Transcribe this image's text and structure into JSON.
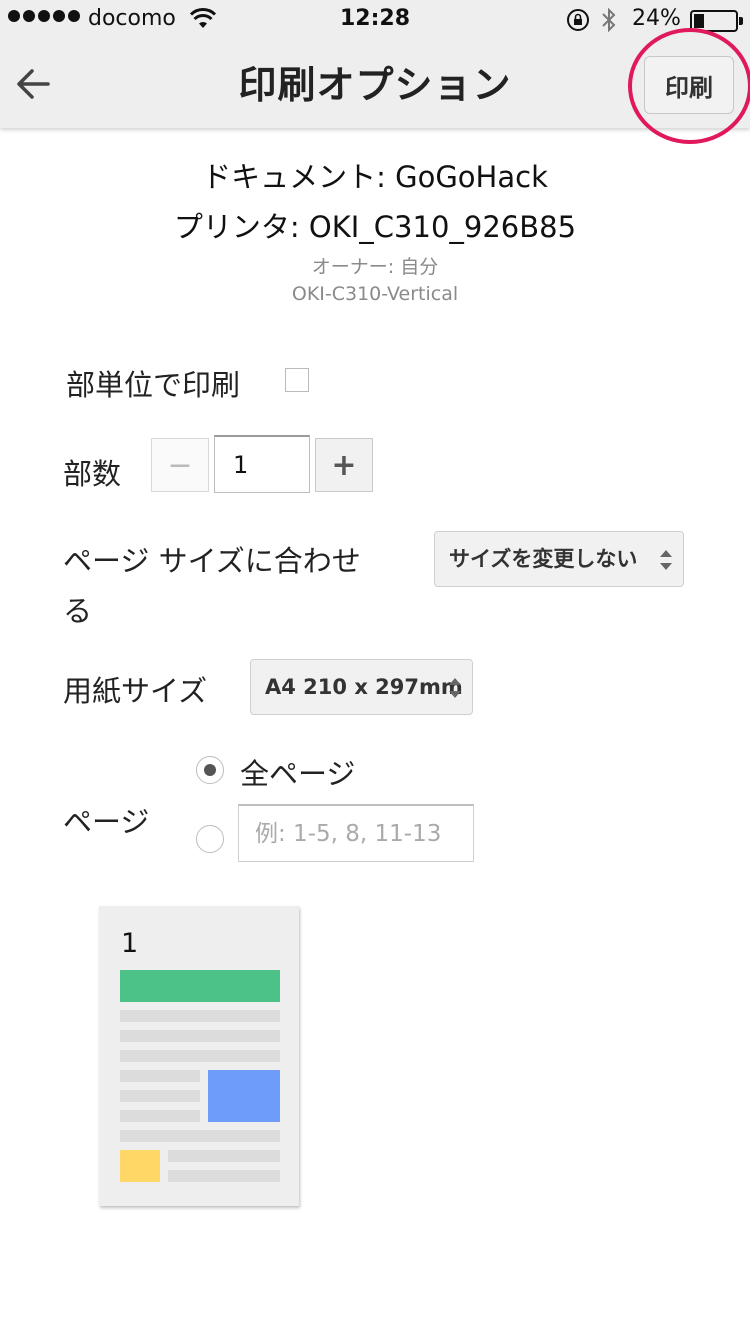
{
  "status_bar": {
    "carrier": "docomo",
    "time": "12:28",
    "battery_percent": "24%",
    "battery_level": 0.24,
    "icons": [
      "signal-dots-icon",
      "wifi-icon",
      "rotation-lock-icon",
      "bluetooth-icon",
      "battery-icon"
    ]
  },
  "header": {
    "back_icon": "arrow-left-icon",
    "title": "印刷オプション",
    "print_label": "印刷",
    "highlight_color": "#e0195a"
  },
  "document": {
    "document_line": "ドキュメント: GoGoHack",
    "printer_line": "プリンタ: OKI_C310_926B85",
    "owner_line": "オーナー: 自分",
    "model_line": "OKI-C310-Vertical"
  },
  "options": {
    "collate_label": "部単位で印刷",
    "collate_checked": false,
    "copies_label": "部数",
    "copies_minus": "−",
    "copies_value": "1",
    "copies_plus": "+",
    "fit_label_line1": "ページ サイズに合わせせ",
    "fit_label_line1_exact": "ページ サイズに合わせ",
    "fit_label_line2": "る",
    "fit_select": "サイズを変更しない",
    "paper_label": "用紙サイズ",
    "paper_select": "A4 210 x 297mm",
    "pages_label": "ページ",
    "pages_all_label": "全ページ",
    "pages_all_selected": true,
    "pages_range_placeholder": "例: 1-5, 8, 11-13"
  },
  "preview": {
    "page_number": "1",
    "colors": {
      "green": "#4cc288",
      "blue": "#6e9cfb",
      "yellow": "#fed766",
      "gray": "#dcdcdc"
    }
  }
}
